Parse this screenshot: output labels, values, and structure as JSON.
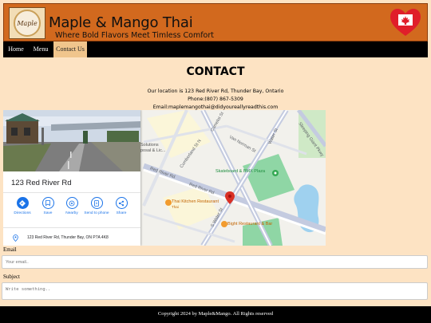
{
  "header": {
    "logo_text": "Maple",
    "title": "Maple & Mango Thai",
    "tagline": "Where Bold Flavors Meet Timless Comfort",
    "logo_icon": "restaurant-logo-icon",
    "flag_icon": "canada-flag-heart-icon"
  },
  "nav": {
    "items": [
      {
        "label": "Home"
      },
      {
        "label": "Menu"
      },
      {
        "label": "Contact Us"
      }
    ],
    "active": "Contact Us"
  },
  "contact": {
    "heading": "CONTACT",
    "location": "Our location is 123 Red River Rd, Thunder Bay, Ontario",
    "phone": "Phone:(807) 867-5309",
    "email": "Email:maplemangothai@didyoureallyreadthis.com"
  },
  "map": {
    "place_name": "123 Red River Rd",
    "address": "123 Red River Rd, Thunder Bay, ON P7A 4K8",
    "actions": [
      {
        "label": "Directions",
        "icon": "directions-icon"
      },
      {
        "label": "Save",
        "icon": "bookmark-icon"
      },
      {
        "label": "Nearby",
        "icon": "nearby-icon"
      },
      {
        "label": "Send to phone",
        "icon": "send-to-phone-icon"
      },
      {
        "label": "Share",
        "icon": "share-icon"
      }
    ],
    "labels": {
      "skateboard": "Skateboard & BMX Plaza",
      "thai_kitchen": "Thai Kitchen Restaurant",
      "thai_kitchen_sub": "Thai",
      "bight": "Bight Restaurant & Bar",
      "solutions": "Solutions",
      "solutions_sub": "posal & Lic...",
      "red_river_1": "Red River Rd",
      "red_river_2": "Red River Rd",
      "cumberland": "Cumberland St N",
      "camelot": "Camelot St",
      "van_norman": "Van Norman St",
      "water": "Water St",
      "s_water": "S Water St",
      "sleeping_giant": "Sleeping Giant Pkwy"
    },
    "colors": {
      "park": "#8fd6a5",
      "water": "#9fd1ef",
      "road": "#c4cbe0",
      "pin": "#d93025",
      "restaurant_pin": "#f29b2e",
      "blue_accent": "#1a73e8"
    }
  },
  "form": {
    "email_label": "Email",
    "email_placeholder": "Your email..",
    "subject_label": "Subject",
    "subject_placeholder": "Write something.."
  },
  "footer": {
    "text": "Copyright 2024 by Maple&Mango. All Rights reserved"
  }
}
